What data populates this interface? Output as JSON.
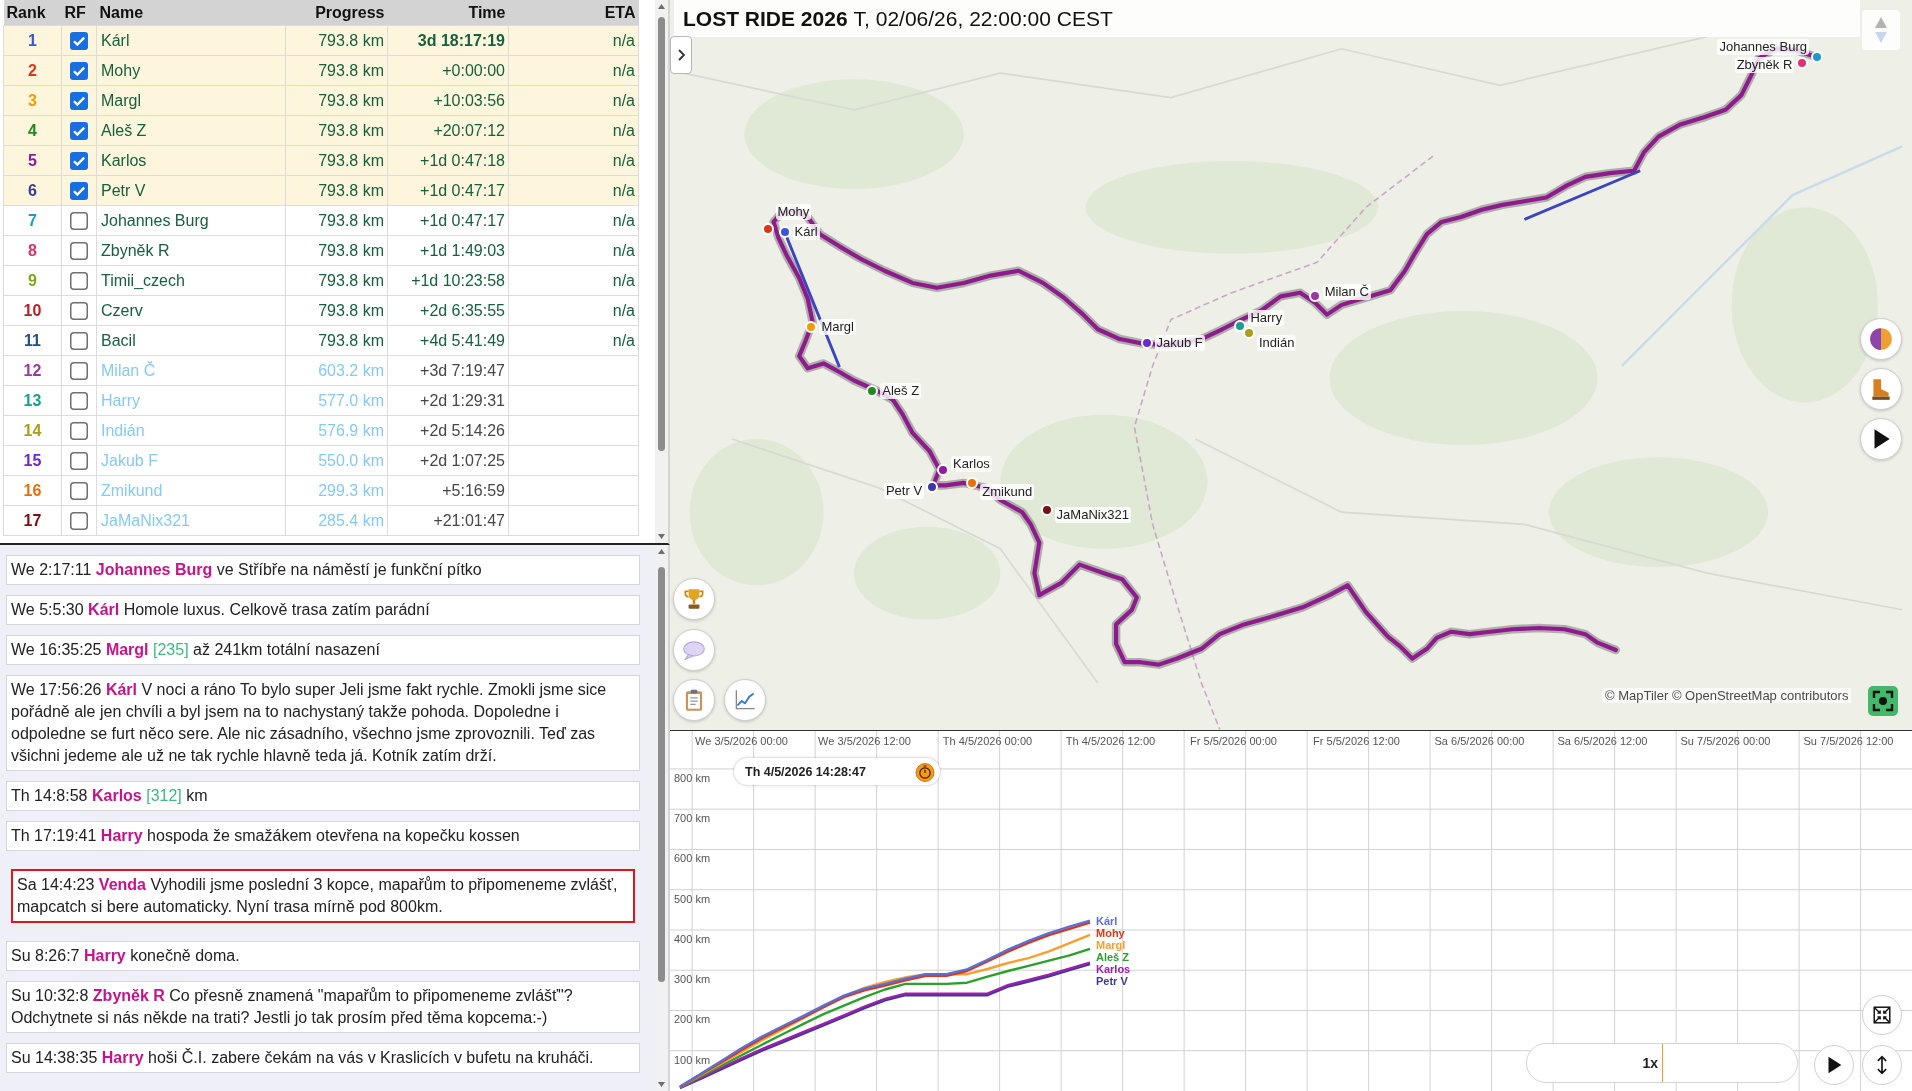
{
  "table": {
    "columns": [
      "Rank",
      "RF",
      "Name",
      "Progress",
      "Time",
      "ETA"
    ],
    "rows": [
      {
        "rank": "1",
        "color": "#3b55d6",
        "checked": true,
        "name": "Kárl",
        "progress": "793.8 km",
        "time": "3d 18:17:19",
        "eta": "n/a",
        "finished": true
      },
      {
        "rank": "2",
        "color": "#d9361a",
        "checked": true,
        "name": "Mohy",
        "progress": "793.8 km",
        "time": "+0:00:00",
        "eta": "n/a",
        "finished": true
      },
      {
        "rank": "3",
        "color": "#f59a00",
        "checked": true,
        "name": "Margl",
        "progress": "793.8 km",
        "time": "+10:03:56",
        "eta": "n/a",
        "finished": true
      },
      {
        "rank": "4",
        "color": "#218a21",
        "checked": true,
        "name": "Aleš Z",
        "progress": "793.8 km",
        "time": "+20:07:12",
        "eta": "n/a",
        "finished": true
      },
      {
        "rank": "5",
        "color": "#8e1a9e",
        "checked": true,
        "name": "Karlos",
        "progress": "793.8 km",
        "time": "+1d 0:47:18",
        "eta": "n/a",
        "finished": true
      },
      {
        "rank": "6",
        "color": "#3b3a9c",
        "checked": true,
        "name": "Petr V",
        "progress": "793.8 km",
        "time": "+1d 0:47:17",
        "eta": "n/a",
        "finished": true
      },
      {
        "rank": "7",
        "color": "#1b9bc9",
        "checked": false,
        "name": "Johannes Burg",
        "progress": "793.8 km",
        "time": "+1d 0:47:17",
        "eta": "n/a",
        "finished": true
      },
      {
        "rank": "8",
        "color": "#e0306f",
        "checked": false,
        "name": "Zbyněk R",
        "progress": "793.8 km",
        "time": "+1d 1:49:03",
        "eta": "n/a",
        "finished": true
      },
      {
        "rank": "9",
        "color": "#7aa81a",
        "checked": false,
        "name": "Timii_czech",
        "progress": "793.8 km",
        "time": "+1d 10:23:58",
        "eta": "n/a",
        "finished": true
      },
      {
        "rank": "10",
        "color": "#b3202a",
        "checked": false,
        "name": "Czerv",
        "progress": "793.8 km",
        "time": "+2d 6:35:55",
        "eta": "n/a",
        "finished": true
      },
      {
        "rank": "11",
        "color": "#2a4d8c",
        "checked": false,
        "name": "Bacil",
        "progress": "793.8 km",
        "time": "+4d 5:41:49",
        "eta": "n/a",
        "finished": true
      },
      {
        "rank": "12",
        "color": "#9b3a9e",
        "checked": false,
        "name": "Milan Č",
        "progress": "603.2 km",
        "time": "+3d 7:19:47",
        "finished": false
      },
      {
        "rank": "13",
        "color": "#1a9e8e",
        "checked": false,
        "name": "Harry",
        "progress": "577.0 km",
        "time": "+2d 1:29:31",
        "finished": false
      },
      {
        "rank": "14",
        "color": "#a8a01a",
        "checked": false,
        "name": "Indián",
        "progress": "576.9 km",
        "time": "+2d 5:14:26",
        "finished": false
      },
      {
        "rank": "15",
        "color": "#6a2ad0",
        "checked": false,
        "name": "Jakub F",
        "progress": "550.0 km",
        "time": "+2d 1:07:25",
        "finished": false
      },
      {
        "rank": "16",
        "color": "#e8700a",
        "checked": false,
        "name": "Zmikund",
        "progress": "299.3 km",
        "time": "+5:16:59",
        "finished": false
      },
      {
        "rank": "17",
        "color": "#7a1010",
        "checked": false,
        "name": "JaMaNix321",
        "progress": "285.4 km",
        "time": "+21:01:47",
        "finished": false
      }
    ]
  },
  "chat": {
    "messages": [
      {
        "day_time": "We 2:17:11",
        "author": "Johannes Burg",
        "text": "ve Stříbře na náměstí je funkční pítko",
        "highlighted": false
      },
      {
        "day_time": "We 5:5:30",
        "author": "Kárl",
        "text": "Homole luxus. Celkově trasa zatím parádní",
        "highlighted": false
      },
      {
        "day_time": "We 16:35:25",
        "author": "Margl",
        "tag": "[235]",
        "text": "až 241km totální nasazení",
        "highlighted": false
      },
      {
        "day_time": "We 17:56:26",
        "author": "Kárl",
        "text": "V noci a ráno To bylo super Jeli jsme fakt rychle. Zmokli jsme sice pořádně ale jen chvíli a byl jsem na to nachystaný takže pohoda. Dopoledne i odpoledne se furt něco sere. Ale nic zásadního, všechno jsme zprovoznili. Teď zas všichni jedeme ale už ne tak rychle hlavně teda já. Kotník zatím drží.",
        "highlighted": false
      },
      {
        "day_time": "Th 14:8:58",
        "author": "Karlos",
        "tag": "[312]",
        "text": "km",
        "highlighted": false
      },
      {
        "day_time": "Th 17:19:41",
        "author": "Harry",
        "text": "hospoda že smažákem otevřena na kopečku kossen",
        "highlighted": false
      },
      {
        "day_time": "Sa 14:4:23",
        "author": "Venda",
        "text": "Vyhodili jsme poslední 3 kopce, mapařům to připomeneme zvlášť, mapcatch si bere automaticky. Nyní trasa mírně pod 800km.",
        "highlighted": true
      },
      {
        "day_time": "Su 8:26:7",
        "author": "Harry",
        "text": "konečně doma.",
        "highlighted": false
      },
      {
        "day_time": "Su 10:32:8",
        "author": "Zbyněk R",
        "text": "Co přesně znamená \"mapařům to připomeneme zvlášť\"? Odchytnete si nás někde na trati? Jestli jo tak prosím před těma kopcema:-)",
        "highlighted": false
      },
      {
        "day_time": "Su 14:38:35",
        "author": "Harry",
        "text": "hoši Č.I. zabere čekám na vás v Kraslicích v bufetu na kruháči.",
        "highlighted": false
      }
    ]
  },
  "map": {
    "title": "LOST RIDE 2026",
    "subtitle": "T, 02/06/26, 22:00:00 CEST",
    "riders": [
      {
        "name": "Kárl",
        "color": "#3b55d6"
      },
      {
        "name": "Mohy",
        "color": "#d9361a"
      },
      {
        "name": "Margl",
        "color": "#f59a00"
      },
      {
        "name": "Aleš Z",
        "color": "#218a21"
      },
      {
        "name": "Karlos",
        "color": "#8e1a9e"
      },
      {
        "name": "Petr V",
        "color": "#3b3a9c"
      },
      {
        "name": "Zmikund",
        "color": "#e8700a"
      },
      {
        "name": "JaMaNix321",
        "color": "#7a1010"
      },
      {
        "name": "Jakub F",
        "color": "#6a2ad0"
      },
      {
        "name": "Harry",
        "color": "#1a9e8e"
      },
      {
        "name": "Indián",
        "color": "#a8a01a"
      },
      {
        "name": "Milan Č",
        "color": "#9b3a9e"
      },
      {
        "name": "Johannes Burg",
        "color": "#1b9bc9"
      },
      {
        "name": "Zbyněk R",
        "color": "#e0306f"
      }
    ],
    "attribution": "© MapTiler © OpenStreetMap contributors"
  },
  "chart": {
    "current_time": "Th 4/5/2026 14:28:47",
    "speed": {
      "reading": "1x",
      "level": 0.5
    },
    "chart_data": {
      "type": "line",
      "grid": true,
      "categories": [
        null,
        null,
        null,
        "We 3/5/2026 00:00",
        null,
        null,
        null,
        null,
        null,
        "We 3/5/2026 12:00",
        null,
        null,
        null,
        null,
        null,
        "Th 4/5/2026 00:00",
        null,
        null,
        null,
        null,
        null,
        "Th 4/5/2026 12:00",
        null,
        null,
        null,
        null,
        null,
        "Fr 5/5/2026 00:00",
        null,
        null,
        null,
        null,
        null,
        "Fr 5/5/2026 12:00",
        null,
        null,
        null,
        null,
        null,
        "Sa 6/5/2026 00:00",
        null,
        null,
        null,
        null,
        null,
        "Sa 6/5/2026 12:00",
        null,
        null,
        null,
        null,
        null,
        "Su 7/5/2026 00:00",
        null,
        null,
        null,
        null,
        null,
        "Su 7/5/2026 12:00",
        null,
        null,
        null
      ],
      "series": [
        {
          "name": "Kárl",
          "color": "#5a6fd4",
          "values": [
            11,
            42,
            74,
            106,
            135,
            161,
            186,
            212,
            237,
            254,
            266,
            279,
            290,
            290,
            302,
            326,
            351,
            373,
            392,
            408,
            423,
            null,
            null,
            null,
            null,
            null,
            null,
            null,
            null,
            null,
            null,
            null,
            null,
            null,
            null,
            null,
            null,
            null,
            null,
            null,
            null,
            null,
            null,
            null,
            null,
            null,
            null,
            null,
            null,
            null,
            null,
            null,
            null,
            null,
            null,
            null,
            null,
            null,
            null,
            null,
            null
          ]
        },
        {
          "name": "Mohy",
          "color": "#d9361a",
          "values": [
            10,
            41,
            71,
            102,
            131,
            157,
            182,
            208,
            233,
            250,
            262,
            275,
            286,
            286,
            298,
            322,
            346,
            368,
            387,
            403,
            418,
            null,
            null,
            null,
            null,
            null,
            null,
            null,
            null,
            null,
            null,
            null,
            null,
            null,
            null,
            null,
            null,
            null,
            null,
            null,
            null,
            null,
            null,
            null,
            null,
            null,
            null,
            null,
            null,
            null,
            null,
            null,
            null,
            null,
            null,
            null,
            null,
            null,
            null,
            null,
            null
          ]
        },
        {
          "name": "Margl",
          "color": "#f5a030",
          "values": [
            10,
            39,
            68,
            97,
            126,
            153,
            181,
            208,
            236,
            256,
            271,
            282,
            290,
            290,
            290,
            303,
            318,
            330,
            347,
            367,
            388,
            null,
            null,
            null,
            null,
            null,
            null,
            null,
            null,
            null,
            null,
            null,
            null,
            null,
            null,
            null,
            null,
            null,
            null,
            null,
            null,
            null,
            null,
            null,
            null,
            null,
            null,
            null,
            null,
            null,
            null,
            null,
            null,
            null,
            null,
            null,
            null,
            null,
            null,
            null,
            null
          ]
        },
        {
          "name": "Aleš Z",
          "color": "#2ca02c",
          "values": [
            9,
            36,
            62,
            89,
            115,
            141,
            166,
            191,
            212,
            233,
            252,
            266,
            266,
            266,
            269,
            284,
            298,
            311,
            324,
            337,
            353,
            null,
            null,
            null,
            null,
            null,
            null,
            null,
            null,
            null,
            null,
            null,
            null,
            null,
            null,
            null,
            null,
            null,
            null,
            null,
            null,
            null,
            null,
            null,
            null,
            null,
            null,
            null,
            null,
            null,
            null,
            null,
            null,
            null,
            null,
            null,
            null,
            null,
            null,
            null,
            null
          ]
        },
        {
          "name": "Karlos",
          "color": "#9b1fa8",
          "values": [
            8,
            32,
            57,
            81,
            104,
            125,
            146,
            167,
            188,
            210,
            229,
            242,
            242,
            242,
            242,
            242,
            263,
            276,
            289,
            304,
            319,
            null,
            null,
            null,
            null,
            null,
            null,
            null,
            null,
            null,
            null,
            null,
            null,
            null,
            null,
            null,
            null,
            null,
            null,
            null,
            null,
            null,
            null,
            null,
            null,
            null,
            null,
            null,
            null,
            null,
            null,
            null,
            null,
            null,
            null,
            null,
            null,
            null,
            null,
            null,
            null
          ]
        },
        {
          "name": "Petr V",
          "color": "#3b3a9c",
          "values": [
            8,
            30,
            54,
            77,
            100,
            121,
            142,
            163,
            184,
            206,
            225,
            238,
            238,
            238,
            238,
            238,
            259,
            272,
            285,
            300,
            315,
            null,
            null,
            null,
            null,
            null,
            null,
            null,
            null,
            null,
            null,
            null,
            null,
            null,
            null,
            null,
            null,
            null,
            null,
            null,
            null,
            null,
            null,
            null,
            null,
            null,
            null,
            null,
            null,
            null,
            null,
            null,
            null,
            null,
            null,
            null,
            null,
            null,
            null,
            null,
            null
          ]
        }
      ],
      "ylim": [
        0,
        894.2
      ],
      "yticks": [
        {
          "value": 100,
          "label": "100 km"
        },
        {
          "value": 200,
          "label": "200 km"
        },
        {
          "value": 300,
          "label": "300 km"
        },
        {
          "value": 400,
          "label": "400 km"
        },
        {
          "value": 500,
          "label": "500 km"
        },
        {
          "value": 600,
          "label": "600 km"
        },
        {
          "value": 700,
          "label": "700 km"
        },
        {
          "value": 800,
          "label": "800 km"
        }
      ]
    }
  }
}
